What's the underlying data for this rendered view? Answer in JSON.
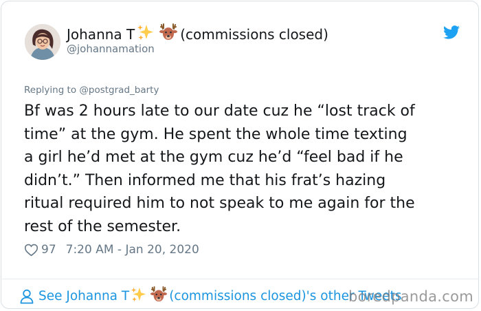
{
  "author": {
    "name": "Johanna T",
    "name_suffix": "(commissions closed)",
    "handle": "@johannamation",
    "sparkles_icon": "sparkles-emoji",
    "deer_icon": "deer-emoji"
  },
  "reply_to": "Replying to @postgrad_barty",
  "tweet": {
    "text": "Bf was 2 hours late to our date cuz he “lost track of\ntime” at the gym. He  spent the whole time texting\na girl he’d met at the gym cuz he’d “feel bad if he\ndidn’t.” Then informed me that his frat’s hazing\nritual required him to not speak to me again for the\nrest of the semester."
  },
  "meta": {
    "likes": "97",
    "timestamp": "7:20 AM - Jan 20, 2020"
  },
  "footer": {
    "prefix": "See Johanna T",
    "suffix": "(commissions closed)'s other Tweets"
  },
  "watermark": "boredpanda.com",
  "colors": {
    "twitter_blue": "#1da1f2",
    "link_blue": "#1b95e0",
    "muted_gray": "#657786",
    "text": "#14171a"
  }
}
